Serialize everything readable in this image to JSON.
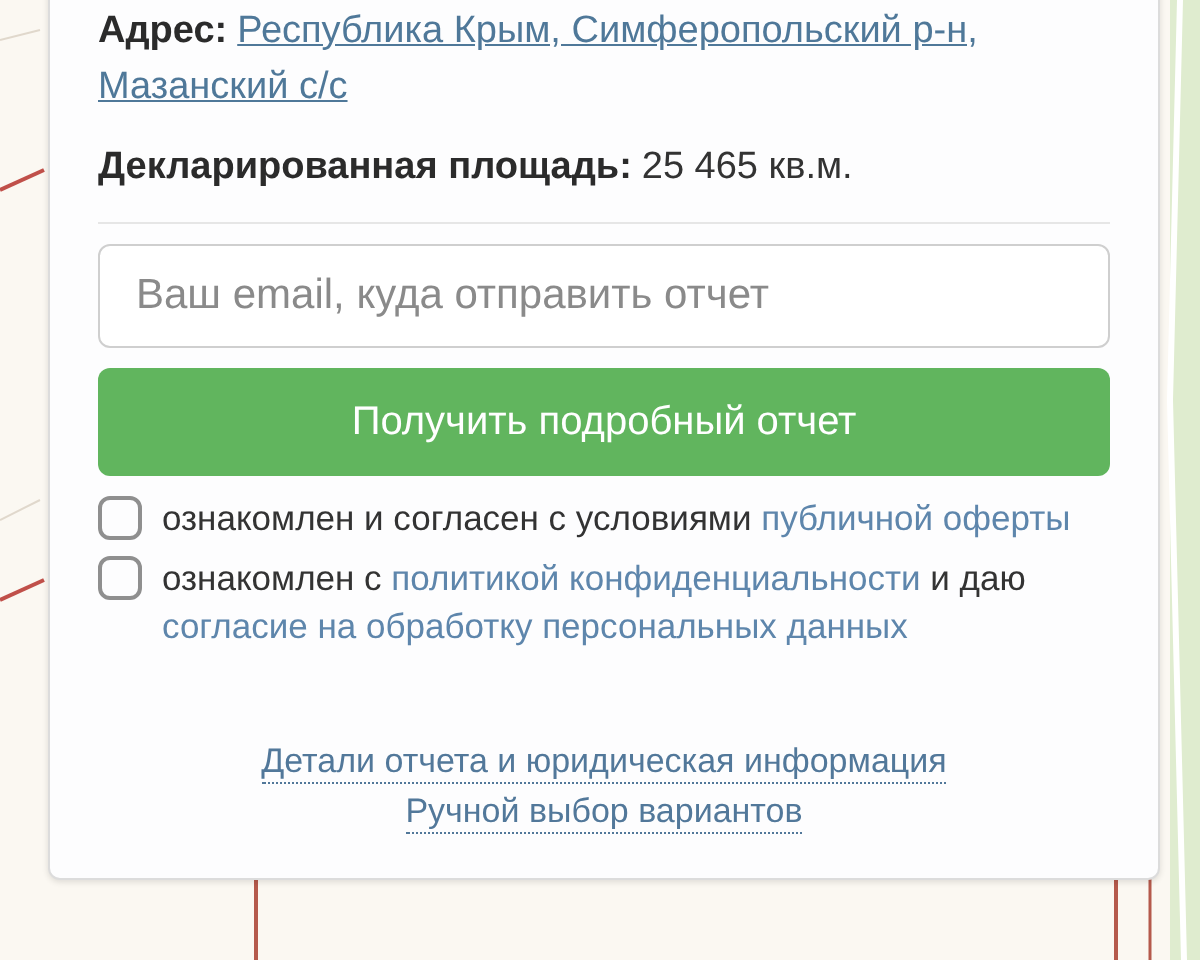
{
  "address": {
    "label": "Адрес:",
    "value_lines": [
      "Республика Крым, Симферопольский р-н,",
      "Мазанский с/с"
    ]
  },
  "area": {
    "label": "Декларированная площадь:",
    "value": "25 465 кв.м."
  },
  "email_field": {
    "placeholder": "Ваш email, куда отправить отчет"
  },
  "submit_button": "Получить подробный отчет",
  "agreements": [
    {
      "checked": false,
      "parts": [
        {
          "text": "ознакомлен и согласен с условиями ",
          "link": false
        },
        {
          "text": "публичной оферты",
          "link": true
        }
      ]
    },
    {
      "checked": false,
      "parts": [
        {
          "text": "ознакомлен с ",
          "link": false
        },
        {
          "text": "политикой конфиденциальности",
          "link": true
        },
        {
          "text": " и даю ",
          "link": false
        },
        {
          "text": "согласие на обработку персональных данных",
          "link": true
        }
      ]
    }
  ],
  "footer_links": [
    "Детали отчета и юридическая информация",
    "Ручной выбор вариантов"
  ]
}
